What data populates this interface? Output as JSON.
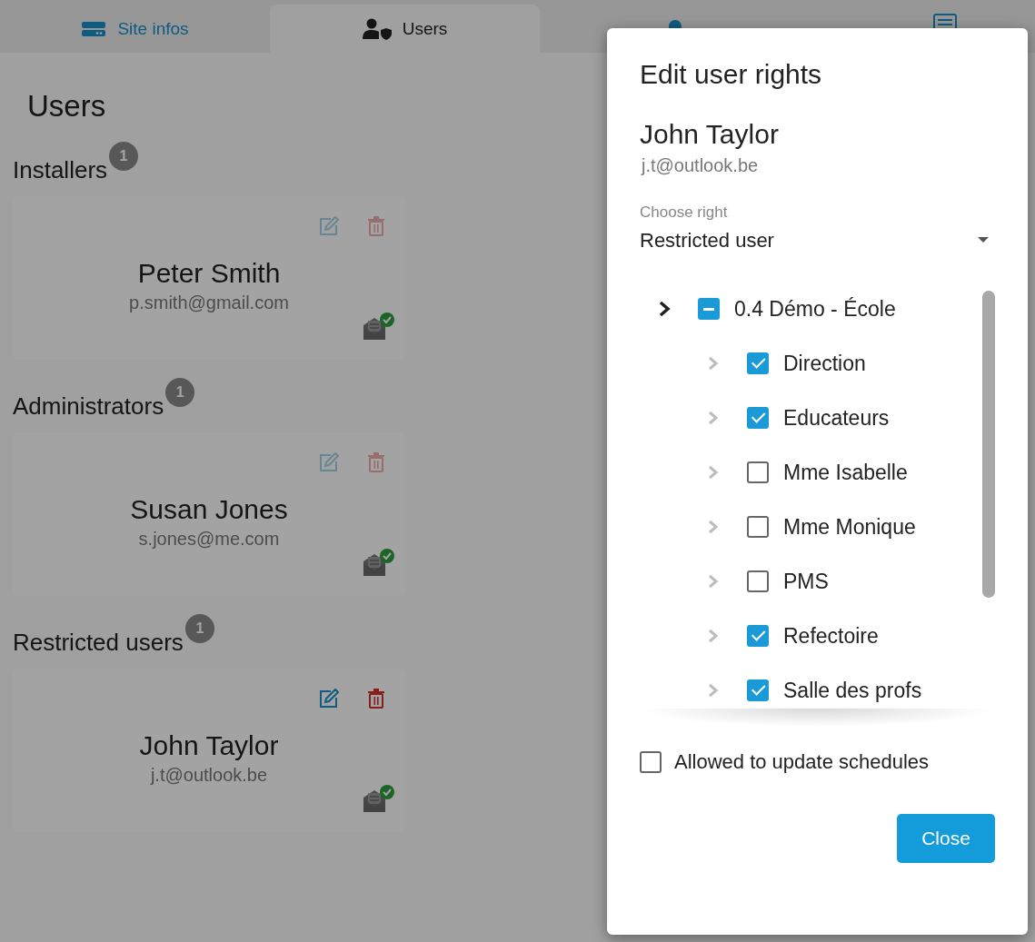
{
  "tabs": [
    {
      "label": "Site infos",
      "selected": false
    },
    {
      "label": "Users",
      "selected": true
    }
  ],
  "page_title": "Users",
  "groups": [
    {
      "title": "Installers",
      "count": "1",
      "users": [
        {
          "name": "Peter Smith",
          "email": "p.smith@gmail.com",
          "active": false
        }
      ]
    },
    {
      "title": "Administrators",
      "count": "1",
      "users": [
        {
          "name": "Susan Jones",
          "email": "s.jones@me.com",
          "active": false
        }
      ]
    },
    {
      "title": "Restricted users",
      "count": "1",
      "users": [
        {
          "name": "John Taylor",
          "email": "j.t@outlook.be",
          "active": true
        }
      ]
    }
  ],
  "dialog": {
    "title": "Edit user rights",
    "user_name": "John Taylor",
    "user_email": "j.t@outlook.be",
    "right_select": {
      "label": "Choose right",
      "value": "Restricted user"
    },
    "tree": [
      {
        "label": "0.4 Démo - École",
        "indeterminate": true,
        "children": [
          {
            "label": "Direction",
            "checked": true
          },
          {
            "label": "Educateurs",
            "checked": true
          },
          {
            "label": "Mme Isabelle",
            "checked": false
          },
          {
            "label": "Mme Monique",
            "checked": false
          },
          {
            "label": "PMS",
            "checked": false
          },
          {
            "label": "Refectoire",
            "checked": true
          },
          {
            "label": "Salle des profs",
            "checked": true
          }
        ]
      }
    ],
    "allow_schedules": {
      "label": "Allowed to update schedules",
      "checked": false
    },
    "close_button": "Close"
  }
}
